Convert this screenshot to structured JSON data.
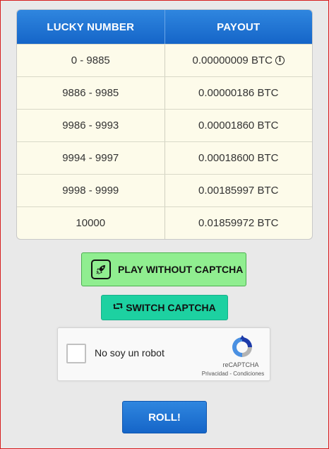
{
  "table": {
    "headers": [
      "LUCKY NUMBER",
      "PAYOUT"
    ],
    "rows": [
      {
        "range": "0 - 9885",
        "payout": "0.00000009 BTC"
      },
      {
        "range": "9886 - 9985",
        "payout": "0.00000186 BTC"
      },
      {
        "range": "9986 - 9993",
        "payout": "0.00001860 BTC"
      },
      {
        "range": "9994 - 9997",
        "payout": "0.00018600 BTC"
      },
      {
        "range": "9998 - 9999",
        "payout": "0.00185997 BTC"
      },
      {
        "range": "10000",
        "payout": "0.01859972 BTC"
      }
    ],
    "info_icon": "info-icon"
  },
  "buttons": {
    "play_without_captcha": "PLAY WITHOUT CAPTCHA",
    "play_icon": "rocket-icon",
    "switch_captcha": "SWITCH CAPTCHA",
    "switch_icon": "retweet-icon",
    "roll": "ROLL!"
  },
  "captcha": {
    "label": "No soy un robot",
    "brand": "reCAPTCHA",
    "privacy": "Privacidad",
    "separator": " - ",
    "terms": "Condiciones",
    "logo_icon": "recaptcha-icon"
  },
  "colors": {
    "header_blue": "#1e74d6",
    "play_green": "#90ee90",
    "switch_teal": "#1dd1a1",
    "table_bg": "#fdfbea",
    "frame_red": "#d61f1f"
  }
}
